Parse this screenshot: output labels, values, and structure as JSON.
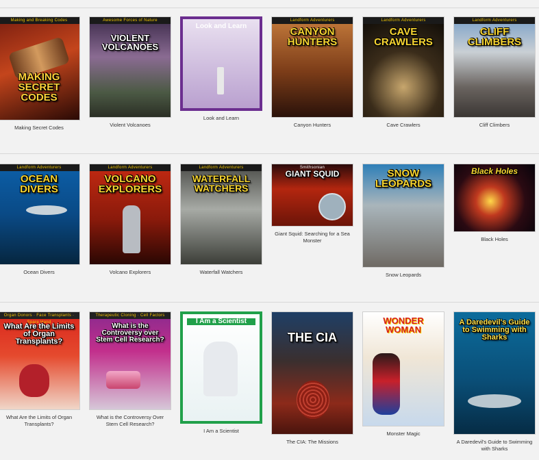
{
  "books": [
    {
      "key": "secret-codes",
      "caption": "Making Secret Codes",
      "cover_title": "Making Secret Codes",
      "series": "Making and Breaking Codes",
      "bg": "linear-gradient(160deg,#7a1e10,#c4451c 45%,#2a0a05)",
      "title_color": "#ffd23a"
    },
    {
      "key": "violent-volcanoes",
      "caption": "Violent Volcanoes",
      "cover_title": "Violent Volcanoes",
      "series": "Awesome Forces of Nature",
      "bg": "linear-gradient(180deg,#3b2a4a,#8a6b92 40%,#4c5a45 75%,#2b2f25)",
      "title_color": "#ffffff"
    },
    {
      "key": "look-and-learn",
      "caption": "Look and Learn",
      "cover_title": "Look and Learn",
      "series": "",
      "bg": "linear-gradient(180deg,#e9e0f0,#b9a0cf)",
      "title_color": "#ffffff"
    },
    {
      "key": "canyon-hunters",
      "caption": "Canyon Hunters",
      "cover_title": "Canyon Hunters",
      "series": "Landform Adventurers",
      "bg": "linear-gradient(180deg,#c57b3c,#7b3c18 55%,#2a120a)",
      "title_color": "#ffd23a"
    },
    {
      "key": "cave-crawlers",
      "caption": "Cave Crawlers",
      "cover_title": "Cave Crawlers",
      "series": "Landform Adventurers",
      "bg": "radial-gradient(circle at 50% 70%,#c7a66d,#3a2c1a 45%,#0d0a06)",
      "title_color": "#ffd23a"
    },
    {
      "key": "cliff-climbers",
      "caption": "Cliff Climbers",
      "cover_title": "Cliff Climbers",
      "series": "Landform Adventurers",
      "bg": "linear-gradient(180deg,#7aa0c8,#c9cfd4 35%,#6a6460 70%,#3a3633)",
      "title_color": "#ffd23a"
    },
    {
      "key": "ocean-divers",
      "caption": "Ocean Divers",
      "cover_title": "Ocean Divers",
      "series": "Landform Adventurers",
      "bg": "linear-gradient(180deg,#0c5fa8,#0a4a86 50%,#06263f)",
      "title_color": "#ffd23a"
    },
    {
      "key": "volcano-explorers",
      "caption": "Volcano Explorers",
      "cover_title": "Volcano Explorers",
      "series": "Landform Adventurers",
      "bg": "linear-gradient(180deg,#c32a12,#8a1a0b 55%,#2a0703)",
      "title_color": "#ffd23a"
    },
    {
      "key": "waterfall-watchers",
      "caption": "Waterfall Watchers",
      "cover_title": "Waterfall Watchers",
      "series": "Landform Adventurers",
      "bg": "linear-gradient(180deg,#4b4c48,#a7aaa5 45%,#3c3e38)",
      "title_color": "#ffd23a"
    },
    {
      "key": "giant-squid",
      "caption": "Giant Squid: Searching for a Sea Monster",
      "cover_title": "Giant Squid",
      "series": "Smithsonian",
      "bg": "linear-gradient(180deg,#2b0b0b,#b3260f 40%,#6b1408)",
      "title_color": "#ffffff"
    },
    {
      "key": "snow-leopards",
      "caption": "Snow Leopards",
      "cover_title": "Snow Leopards",
      "series": "",
      "bg": "linear-gradient(180deg,#2f7fb8,#a9b5bb 40%,#6f6a64)",
      "title_color": "#ffd23a"
    },
    {
      "key": "black-holes",
      "caption": "Black Holes",
      "cover_title": "Black Holes",
      "series": "",
      "bg": "radial-gradient(circle at 45% 55%,#ffd84a,#c0391f 25%,#2a0a12 60%,#06030a)",
      "title_color": "#ffe14a"
    },
    {
      "key": "organ-transplants",
      "caption": "What Are the Limits of Organ Transplants?",
      "cover_title": "What Are the Limits of Organ Transplants?",
      "series": "Organ Donors · Face Transplants · Spare Hand",
      "bg": "linear-gradient(180deg,#d9261c,#e54a2e 45%,#f0d6c8)",
      "title_color": "#ffffff"
    },
    {
      "key": "stem-cell",
      "caption": "What is the Controversy Over Stem Cell Research?",
      "cover_title": "What is the Controversy over Stem Cell Research?",
      "series": "Therapeutic Cloning · Cell Factors",
      "bg": "linear-gradient(180deg,#8a2a8e,#c22f8c 40%,#d6c7d8)",
      "title_color": "#ffffff"
    },
    {
      "key": "i-am-a-scientist",
      "caption": "I Am a Scientist",
      "cover_title": "I Am a Scientist",
      "series": "",
      "bg": "linear-gradient(180deg,#ffffff,#e9f2f3)",
      "title_color": "#ffffff"
    },
    {
      "key": "the-cia",
      "caption": "The CIA: The Missions",
      "cover_title": "The CIA",
      "series": "",
      "bg": "linear-gradient(180deg,#1f3f66,#3a2f2f 40%,#8c2a1a 75%,#4a140d)",
      "title_color": "#ffffff"
    },
    {
      "key": "monster-magic",
      "caption": "Monster Magic",
      "cover_title": "Wonder Woman",
      "series": "",
      "bg": "linear-gradient(180deg,#ffffff,#f0e6d6 40%,#c7d9ec)",
      "title_color": "#d61e1e"
    },
    {
      "key": "swimming-with-sharks",
      "caption": "A Daredevil's Guide to Swimming with Sharks",
      "cover_title": "A Daredevil's Guide to Swimming with Sharks",
      "series": "",
      "bg": "linear-gradient(180deg,#0c6c9c,#0a4f78 55%,#062c45)",
      "title_color": "#ffe14a"
    }
  ]
}
